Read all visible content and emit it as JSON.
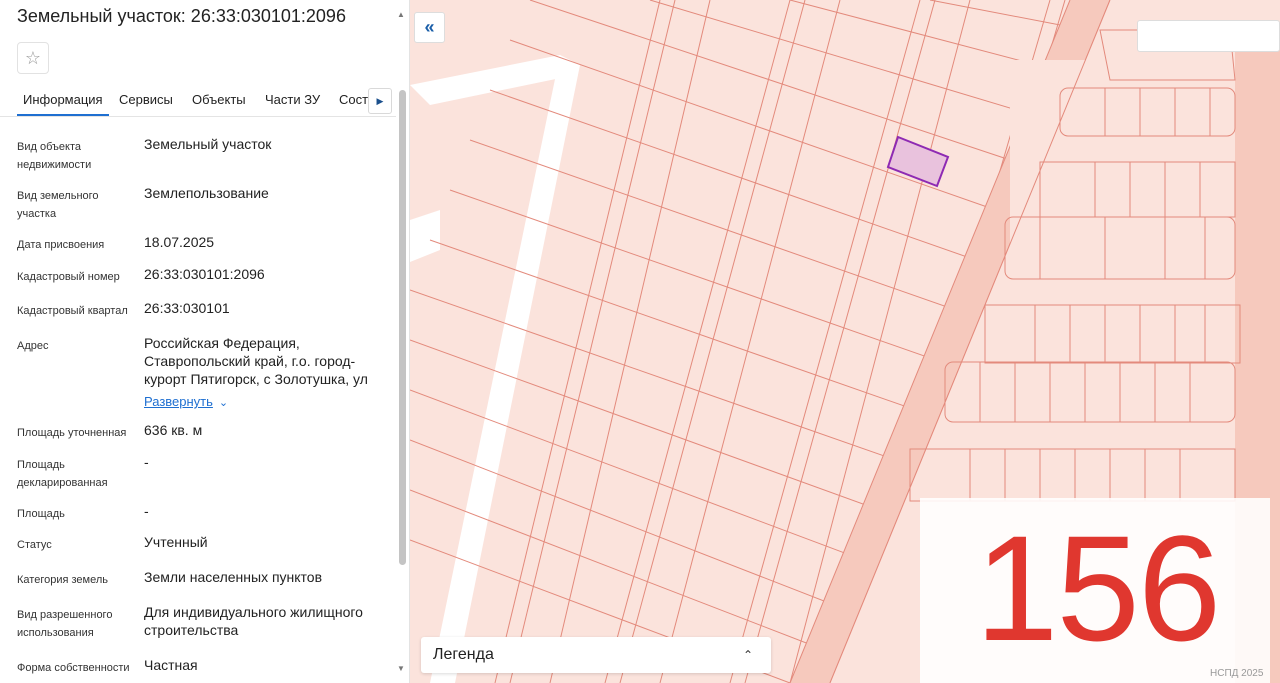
{
  "panel": {
    "title": "Земельный участок: 26:33:030101:2096",
    "favorite_icon": "star-icon",
    "tabs": [
      {
        "label": "Информация"
      },
      {
        "label": "Сервисы"
      },
      {
        "label": "Объекты"
      },
      {
        "label": "Части ЗУ"
      },
      {
        "label": "Соста"
      }
    ],
    "fields": [
      {
        "label": "Вид объекта недвижимости",
        "value": "Земельный участок"
      },
      {
        "label": "Вид земельного участка",
        "value": "Землепользование"
      },
      {
        "label": "Дата присвоения",
        "value": "18.07.2025"
      },
      {
        "label": "Кадастровый номер",
        "value": "26:33:030101:2096"
      },
      {
        "label": "Кадастровый квартал",
        "value": "26:33:030101"
      },
      {
        "label": "Адрес",
        "value": "Российская Федерация, Ставропольский край, г.о. город-курорт Пятигорск, с Золотушка, ул"
      },
      {
        "label": "Площадь уточненная",
        "value": "636 кв. м"
      },
      {
        "label": "Площадь декларированная",
        "value": "-"
      },
      {
        "label": "Площадь",
        "value": "-"
      },
      {
        "label": "Статус",
        "value": "Учтенный"
      },
      {
        "label": "Категория земель",
        "value": "Земли населенных пунктов"
      },
      {
        "label": "Вид разрешенного использования",
        "value": "Для индивидуального жилищного строительства"
      },
      {
        "label": "Форма собственности",
        "value": "Частная"
      }
    ],
    "expand_label": "Развернуть"
  },
  "map": {
    "legend_label": "Легенда",
    "watermark": "156",
    "copyright": "НСПД 2025",
    "colors": {
      "background": "#fbe3dc",
      "parcel_line": "#e38a7c",
      "road": "#ffffff",
      "selected": "#8e2ab3"
    }
  }
}
